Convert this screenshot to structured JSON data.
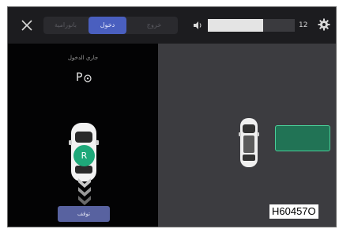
{
  "topbar": {
    "close_icon": "close-icon",
    "segments": [
      {
        "label": "بانورامية",
        "active": false
      },
      {
        "label": "دخول",
        "active": true
      },
      {
        "label": "خروج",
        "active": false
      }
    ],
    "volume_icon": "speaker-icon",
    "volume_level": 12,
    "volume_fill_fraction": 0.64,
    "settings_icon": "gear-icon"
  },
  "left_panel": {
    "status": "جاري الدخول",
    "park_icon": "auto-park-icon",
    "gear_indicator": "R",
    "stop_button": "توقف"
  },
  "right_panel": {
    "target_spot_color": "#1f7a58"
  },
  "figure_code": "H60457O",
  "colors": {
    "accent": "#4a5fbf",
    "reverse_badge": "#1fa97a",
    "stop_button": "#5862a0"
  }
}
